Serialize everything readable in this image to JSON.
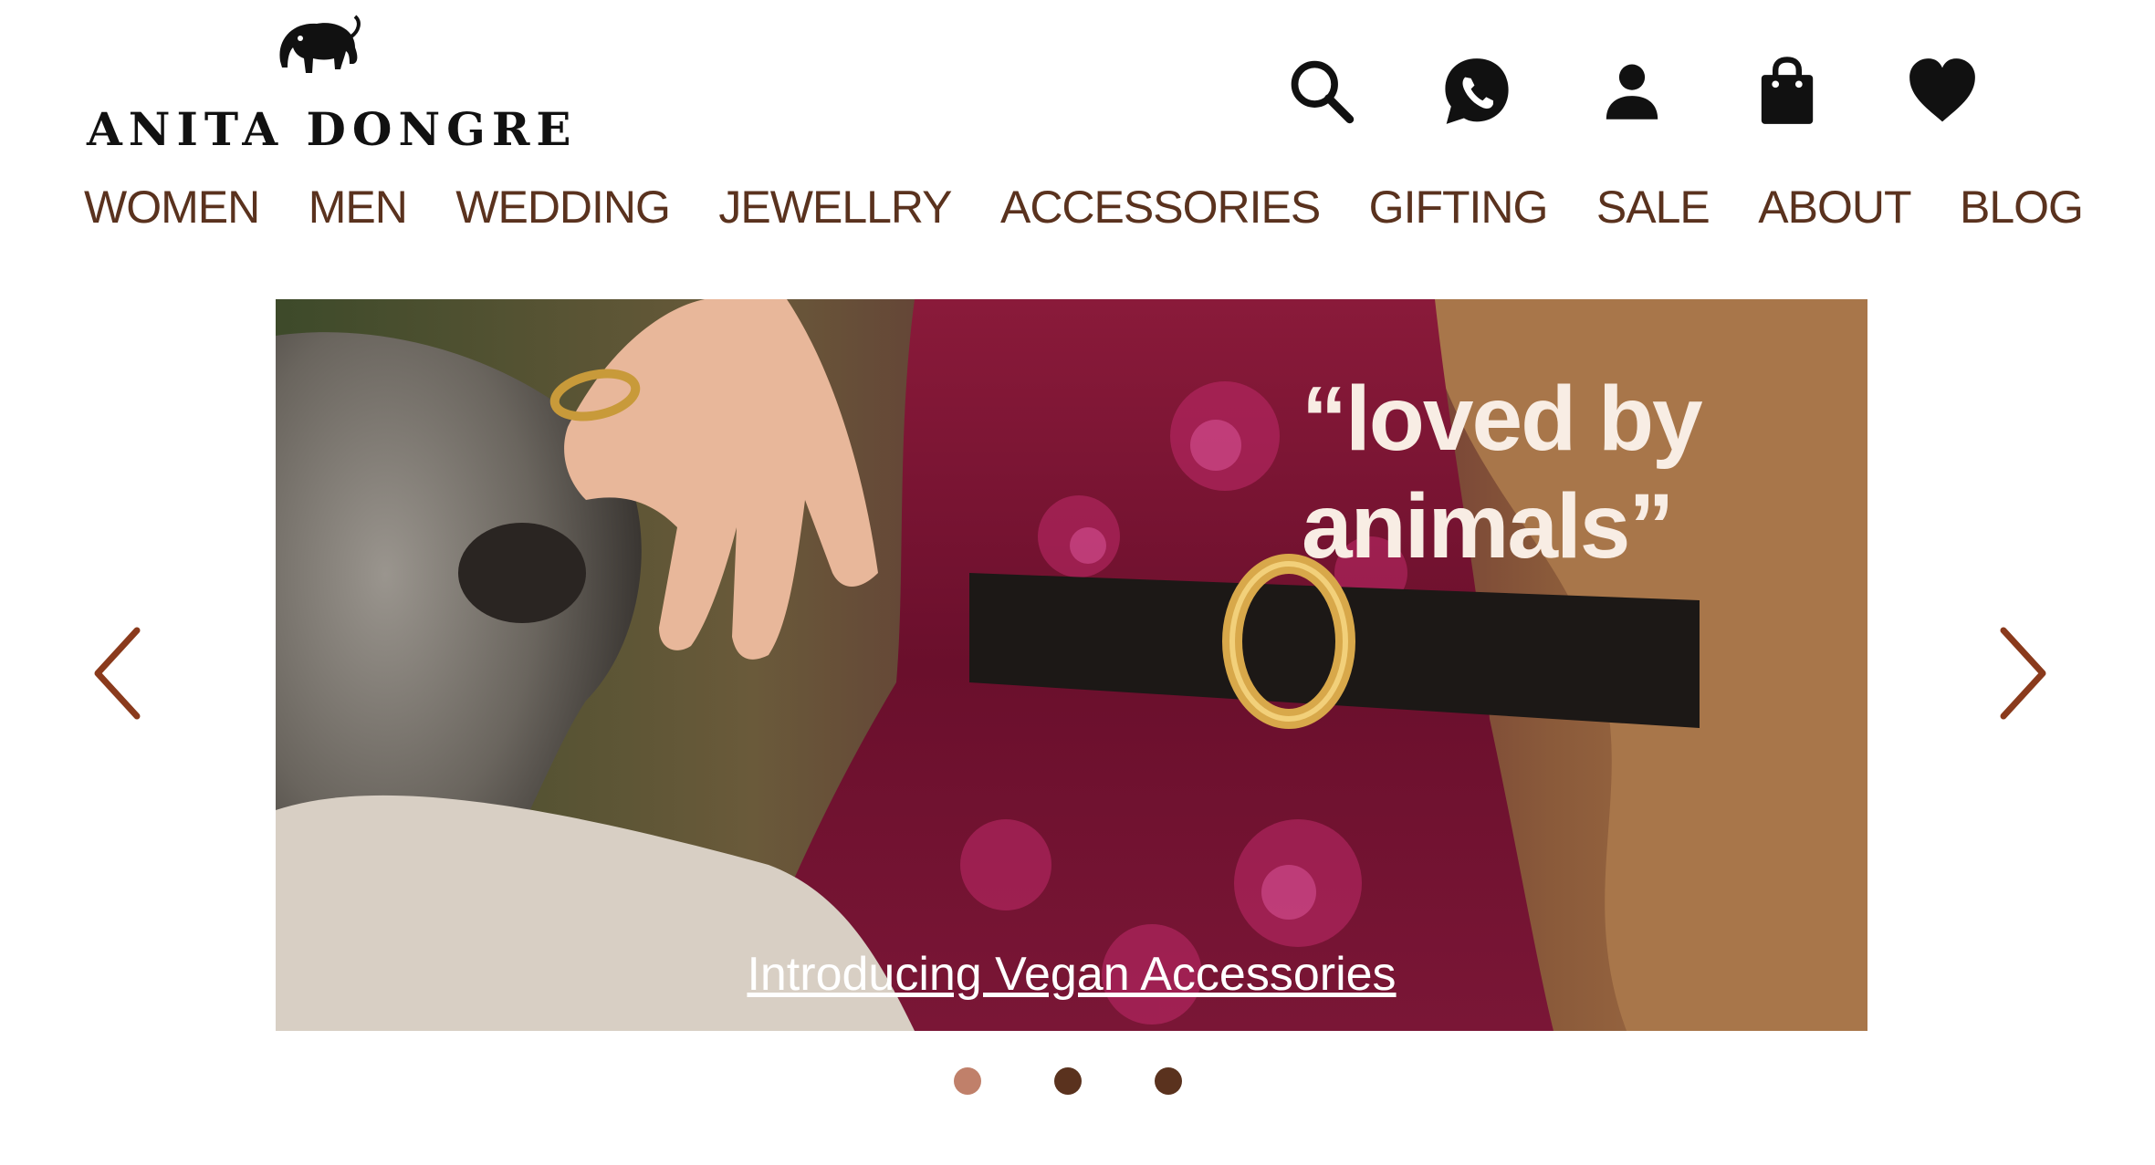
{
  "brand": {
    "name": "ANITA DONGRE",
    "logo_icon": "elephant-logo-icon"
  },
  "header_icons": [
    {
      "name": "search-icon"
    },
    {
      "name": "whatsapp-icon"
    },
    {
      "name": "account-icon"
    },
    {
      "name": "shopping-bag-icon"
    },
    {
      "name": "wishlist-heart-icon"
    }
  ],
  "nav": {
    "items": [
      "WOMEN",
      "MEN",
      "WEDDING",
      "JEWELLRY",
      "ACCESSORIES",
      "GIFTING",
      "SALE",
      "ABOUT",
      "BLOG"
    ]
  },
  "hero": {
    "headline": "“loved by animals”",
    "cta": "Introducing Vegan Accessories",
    "prev_icon": "chevron-left-icon",
    "next_icon": "chevron-right-icon",
    "slides_total": 3,
    "active_slide": 1
  },
  "colors": {
    "nav_text": "#5a321e",
    "arrow": "#8a3a1c",
    "dot_active": "#c0806a",
    "dot_inactive": "#5a321e"
  }
}
